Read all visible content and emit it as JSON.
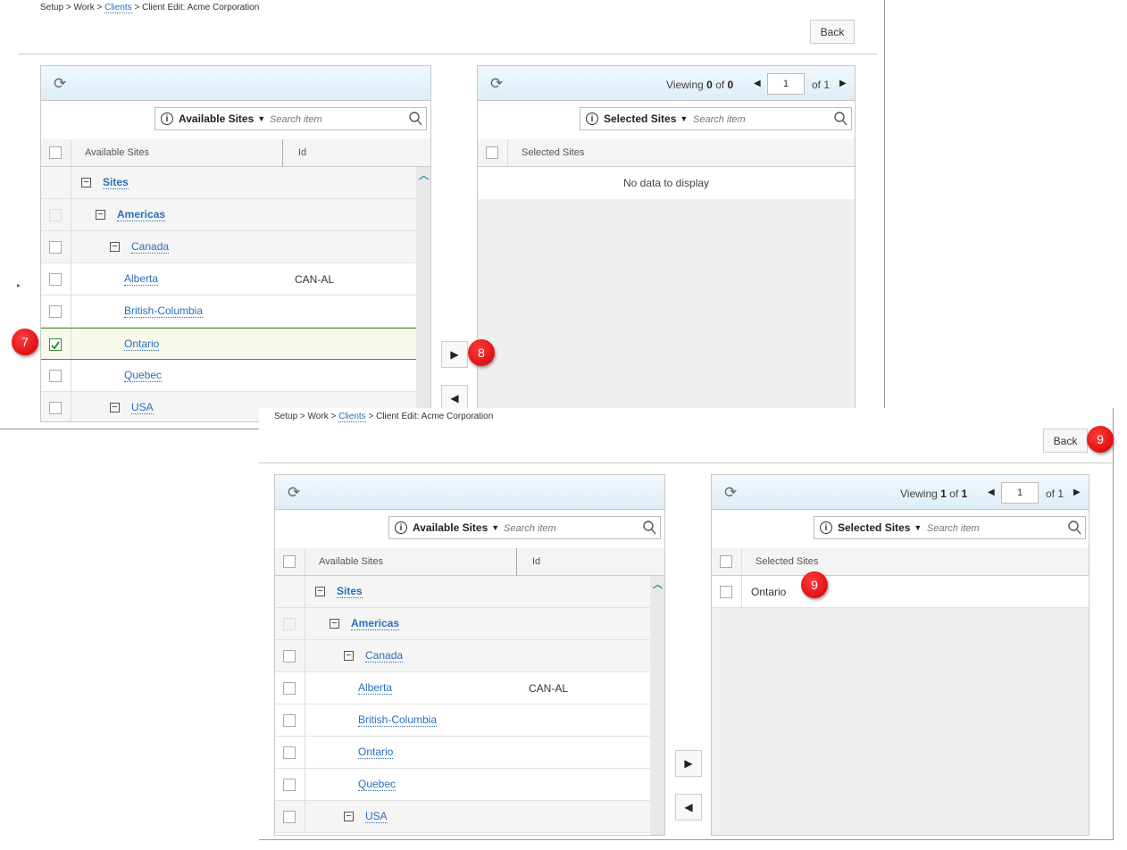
{
  "breadcrumb": {
    "items": [
      "Setup",
      "Work",
      "Clients",
      "Client Edit: Acme Corporation"
    ],
    "separator": ">"
  },
  "back_label": "Back",
  "available": {
    "dropdown_label": "Available Sites",
    "search_placeholder": "Search item",
    "col_name": "Available Sites",
    "col_id": "Id",
    "tree": [
      {
        "label": "Sites",
        "level": 0,
        "expander": "−",
        "id": ""
      },
      {
        "label": "Americas",
        "level": 1,
        "expander": "−",
        "id": ""
      },
      {
        "label": "Canada",
        "level": 2,
        "expander": "−",
        "id": ""
      },
      {
        "label": "Alberta",
        "level": 3,
        "id": "CAN-AL"
      },
      {
        "label": "British-Columbia",
        "level": 3,
        "id": ""
      },
      {
        "label": "Ontario",
        "level": 3,
        "id": ""
      },
      {
        "label": "Quebec",
        "level": 3,
        "id": ""
      },
      {
        "label": "USA",
        "level": 2,
        "expander": "−",
        "id": ""
      }
    ]
  },
  "selected": {
    "dropdown_label": "Selected Sites",
    "search_placeholder": "Search item",
    "col_name": "Selected Sites",
    "viewing_label": "Viewing",
    "of_label": "of",
    "no_data": "No data to display"
  },
  "step1": {
    "viewing_from": "0",
    "viewing_total": "0",
    "page": "1",
    "page_total": "1",
    "checked_item": "Ontario"
  },
  "step2": {
    "viewing_from": "1",
    "viewing_total": "1",
    "page": "1",
    "page_total": "1",
    "selected_item": "Ontario"
  },
  "buttons": {
    "move_right": "▶",
    "move_left": "◀"
  },
  "markers": [
    "7",
    "8",
    "9",
    "9"
  ],
  "icons": {
    "refresh": "refresh-icon",
    "info": "info-icon",
    "search": "search-icon",
    "caret": "caret-down-icon",
    "expand": "expand-collapse-icon",
    "scroll_up": "chevron-up-icon",
    "prev": "chevron-left-icon",
    "next": "chevron-right-icon"
  },
  "colors": {
    "link": "#2a6ebb",
    "marker": "#d00000",
    "header_grad_top": "#f1f8fd",
    "header_grad_bottom": "#deedf7",
    "checked": "#3a8a3a"
  }
}
